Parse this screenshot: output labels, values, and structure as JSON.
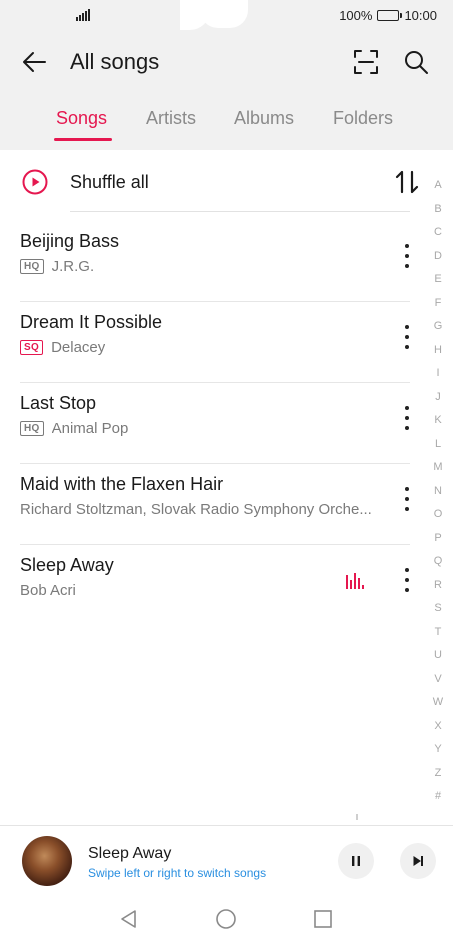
{
  "status_bar": {
    "battery": "100%",
    "time": "10:00"
  },
  "header": {
    "title": "All songs"
  },
  "tabs": [
    {
      "label": "Songs",
      "active": true
    },
    {
      "label": "Artists",
      "active": false
    },
    {
      "label": "Albums",
      "active": false
    },
    {
      "label": "Folders",
      "active": false
    }
  ],
  "shuffle": {
    "label": "Shuffle all"
  },
  "songs": [
    {
      "title": "Beijing Bass",
      "badge": "HQ",
      "artist": "J.R.G."
    },
    {
      "title": "Dream It Possible",
      "badge": "SQ",
      "artist": "Delacey"
    },
    {
      "title": "Last Stop",
      "badge": "HQ",
      "artist": "Animal Pop"
    },
    {
      "title": "Maid with the Flaxen Hair",
      "badge": "",
      "artist": "Richard Stoltzman, Slovak Radio Symphony Orche..."
    },
    {
      "title": "Sleep Away",
      "badge": "",
      "artist": "Bob Acri",
      "playing": true
    }
  ],
  "alpha_index": [
    "A",
    "B",
    "C",
    "D",
    "E",
    "F",
    "G",
    "H",
    "I",
    "J",
    "K",
    "L",
    "M",
    "N",
    "O",
    "P",
    "Q",
    "R",
    "S",
    "T",
    "U",
    "V",
    "W",
    "X",
    "Y",
    "Z",
    "#"
  ],
  "now_playing": {
    "title": "Sleep Away",
    "hint": "Swipe left or right to switch songs"
  },
  "colors": {
    "accent": "#e5174f",
    "hint": "#2a8fe0"
  },
  "icons": {
    "back": "arrow-left-icon",
    "scan": "scan-icon",
    "search": "search-icon",
    "shuffle": "play-circle-icon",
    "sort": "sort-icon",
    "more": "more-vertical-icon"
  }
}
